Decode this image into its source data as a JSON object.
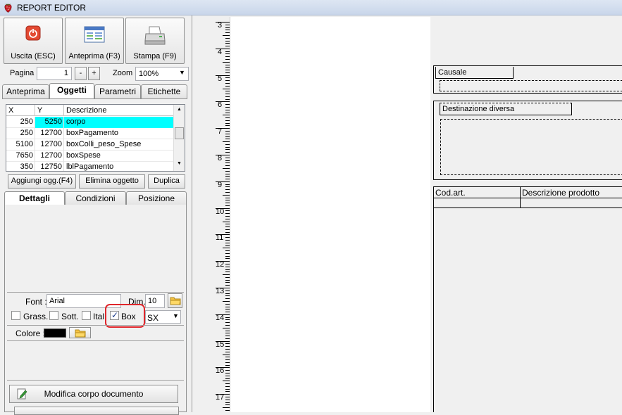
{
  "window": {
    "title": "REPORT EDITOR"
  },
  "toolbar": {
    "exit_label": "Uscita (ESC)",
    "preview_label": "Anteprima (F3)",
    "print_label": "Stampa (F9)"
  },
  "pagination": {
    "page_label": "Pagina",
    "page_value": "1",
    "minus_label": "-",
    "plus_label": "+",
    "zoom_label": "Zoom",
    "zoom_value": "100%"
  },
  "top_tabs": [
    "Anteprima",
    "Oggetti",
    "Parametri",
    "Etichette"
  ],
  "grid": {
    "headers": [
      "X",
      "Y",
      "Descrizione"
    ],
    "rows": [
      {
        "x": "250",
        "y": "5250",
        "desc": "corpo"
      },
      {
        "x": "250",
        "y": "12700",
        "desc": "boxPagamento"
      },
      {
        "x": "5100",
        "y": "12700",
        "desc": "boxColli_peso_Spese"
      },
      {
        "x": "7650",
        "y": "12700",
        "desc": "boxSpese"
      },
      {
        "x": "350",
        "y": "12750",
        "desc": "lblPagamento"
      }
    ]
  },
  "object_actions": {
    "add_label": "Aggiungi ogg.(F4)",
    "delete_label": "Elimina oggetto",
    "duplicate_label": "Duplica"
  },
  "detail_tabs": [
    "Dettagli",
    "Condizioni",
    "Posizione"
  ],
  "font_settings": {
    "font_label": "Font :",
    "font_value": "Arial",
    "dim_label": "Dim.",
    "dim_value": "10",
    "bold_label": "Grass.",
    "underline_label": "Sott.",
    "italic_label": "Ital",
    "box_label": "Box",
    "box_checked": true,
    "align_value": "SX",
    "color_label": "Colore :",
    "color_value": "#000000"
  },
  "bottom_actions": {
    "edit_body_label": "Modifica corpo documento"
  },
  "ruler": {
    "marks": [
      "3",
      "4",
      "5",
      "6",
      "7",
      "8",
      "9",
      "10",
      "11",
      "12",
      "13",
      "14",
      "15",
      "16",
      "17"
    ]
  },
  "document": {
    "causale_label": "Causale",
    "destinazione_label": "Destinazione diversa",
    "col_codart": "Cod.art.",
    "col_descrizione": "Descrizione prodotto"
  },
  "colors": {
    "highlight": "#00ffff",
    "annotation": "#e0262b"
  }
}
